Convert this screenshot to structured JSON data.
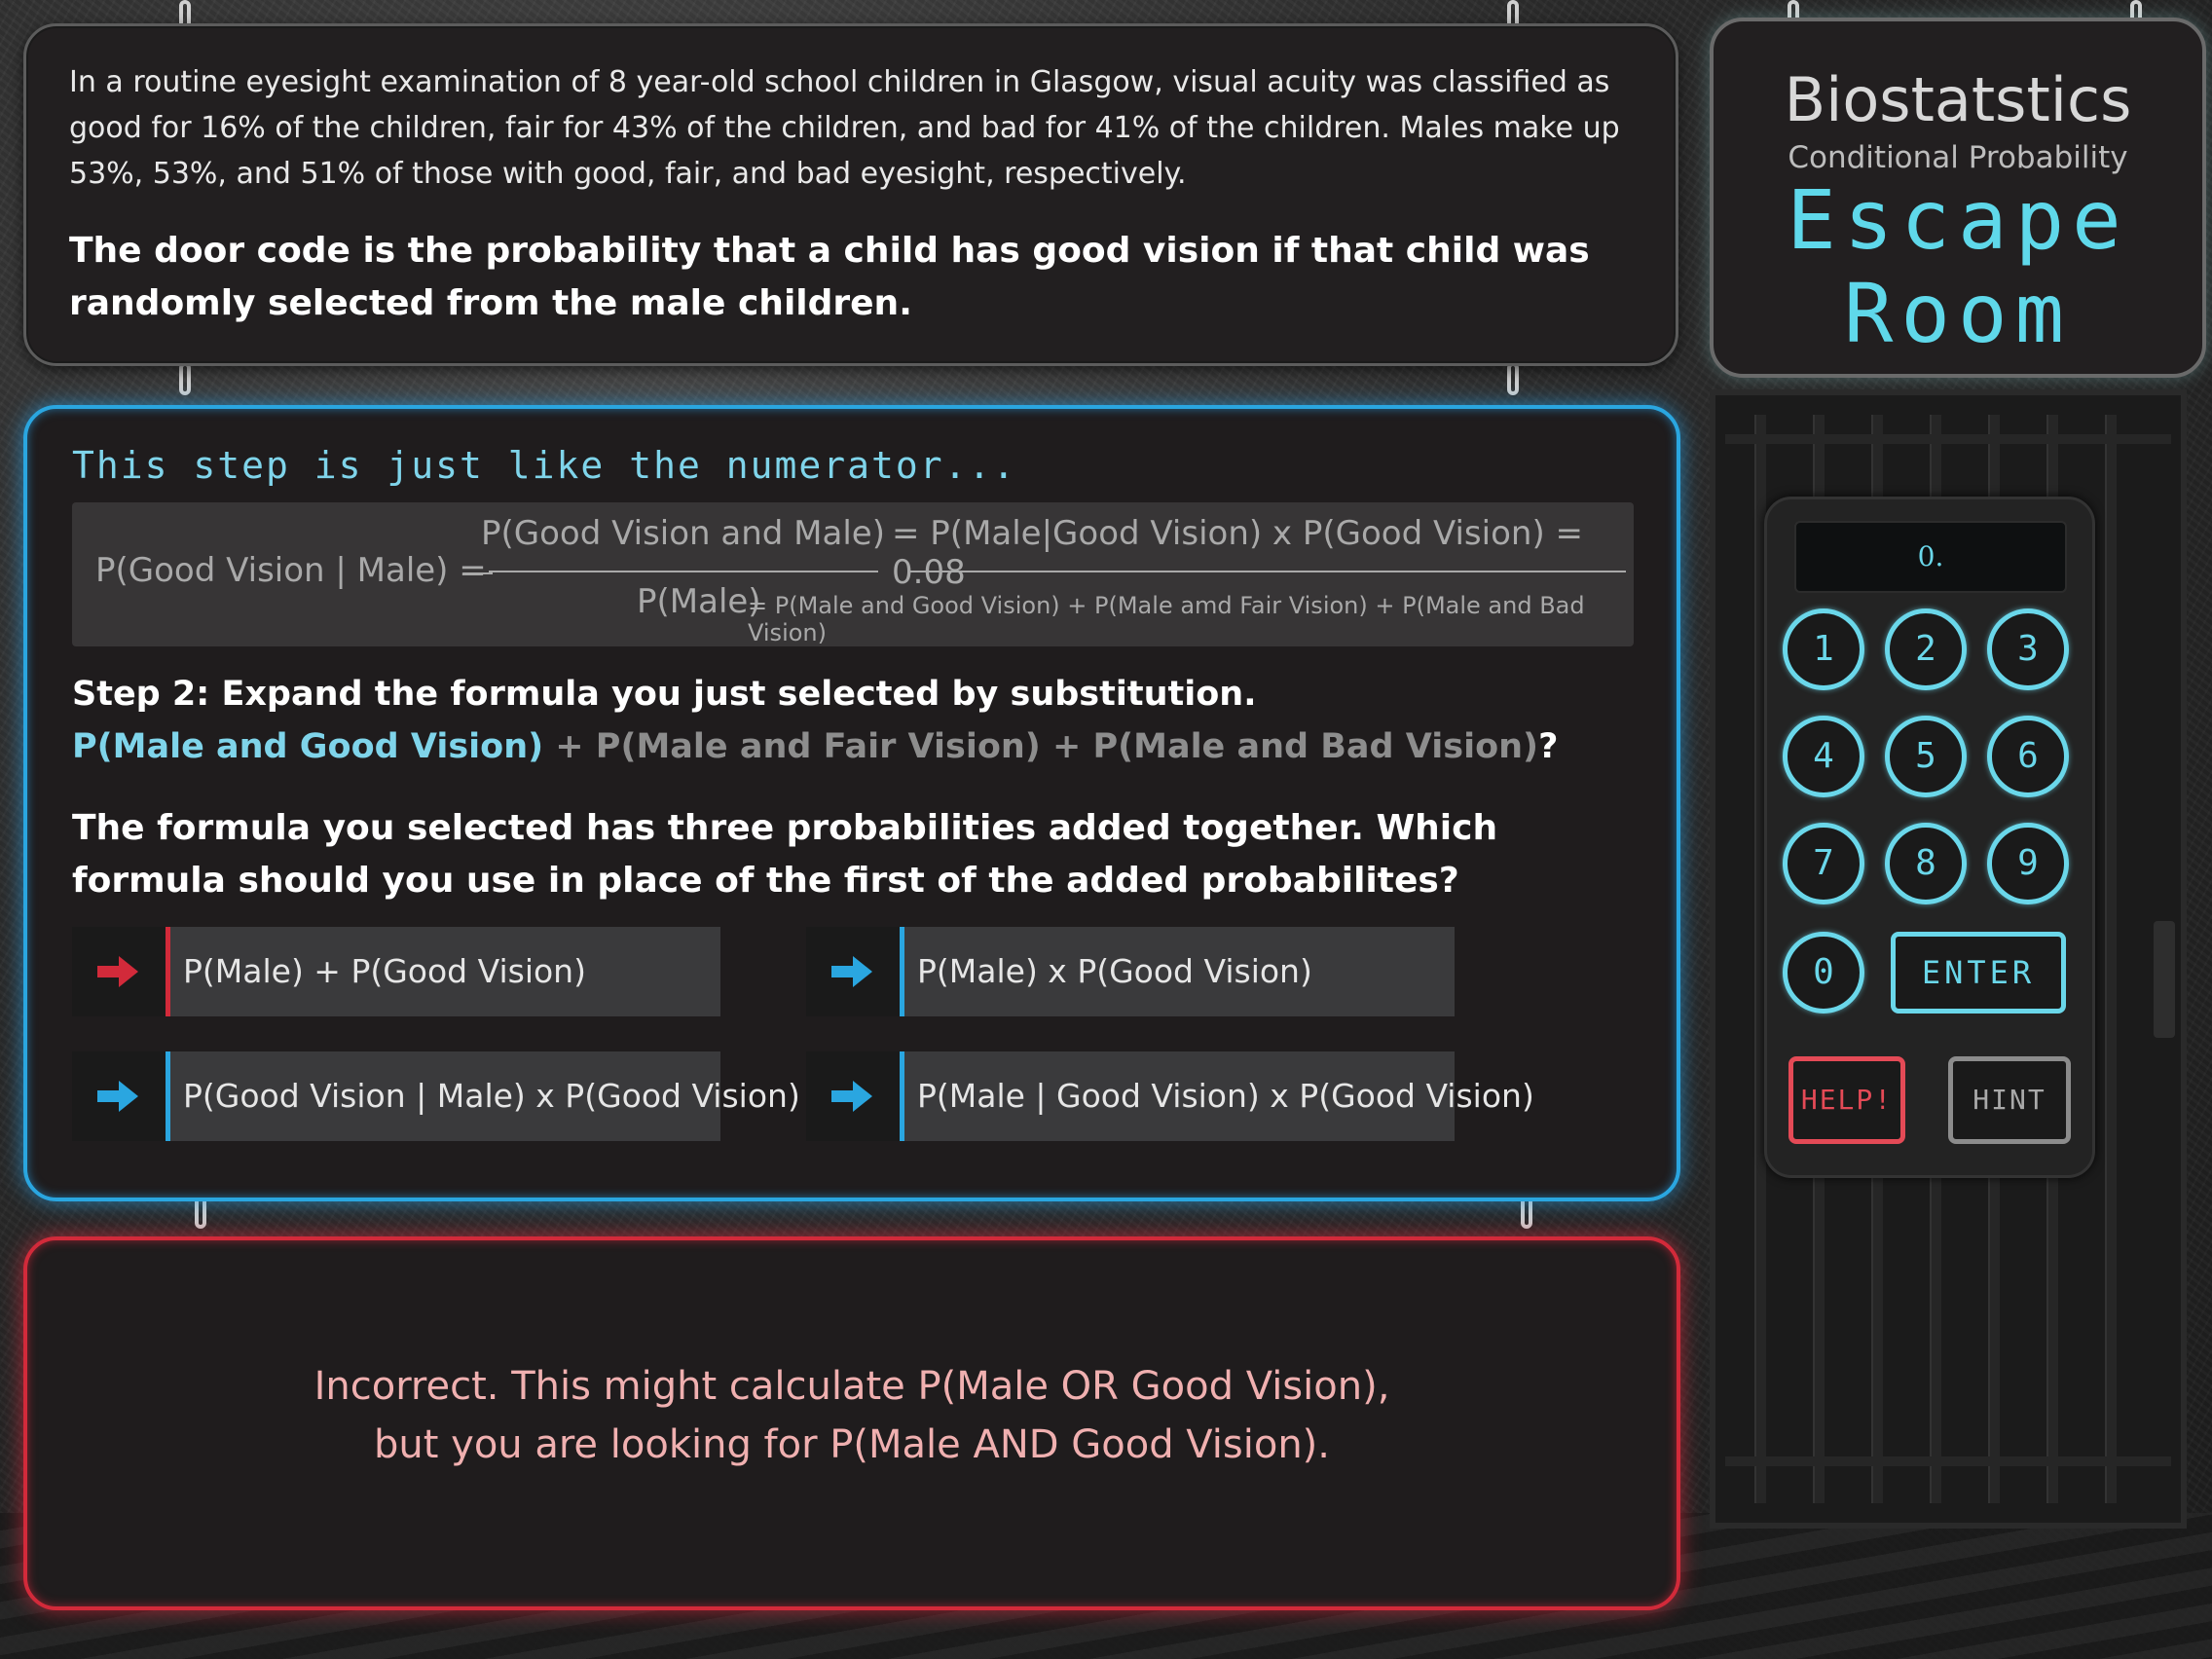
{
  "intro": "In a routine eyesight examination of 8 year-old school children in Glasgow, visual acuity was classified as good for 16% of the children, fair for 43% of the children, and bad for 41% of the children. Males make up 53%, 53%, and 51% of those with good, fair, and bad eyesight, respectively.",
  "question": "The door code is the probability that a child has good vision if that child was randomly selected from the male children.",
  "title": {
    "main": "Biostatstics",
    "sub": "Conditional Probability",
    "escape": "Escape",
    "room": "Room"
  },
  "step_header": "This step is just like the numerator...",
  "formula": {
    "lhs": "P(Good Vision | Male) =",
    "numerator": "P(Good Vision and Male)",
    "numerator_expand": "= P(Male|Good Vision) x P(Good Vision) = 0.08",
    "denominator": "P(Male)",
    "denominator_expand": "= P(Male and Good Vision) + P(Male amd Fair Vision) + P(Male and Bad Vision)"
  },
  "step2": {
    "title": "Step 2: Expand the formula you just selected by substitution.",
    "part_a": "P(Male and Good Vision)",
    "part_b": " + P(Male and Fair Vision) + P(Male and Bad Vision)",
    "part_c": "?"
  },
  "step3": "The formula you selected has three probabilities added together. Which formula should you use in place of the first of the added probabilites?",
  "options": [
    {
      "label": "P(Male) + P(Good Vision)",
      "state": "wrong"
    },
    {
      "label": "P(Male) x P(Good Vision)",
      "state": "normal"
    },
    {
      "label": "P(Good Vision | Male) x P(Good Vision)",
      "state": "normal"
    },
    {
      "label": "P(Male | Good Vision) x P(Good Vision)",
      "state": "normal"
    }
  ],
  "feedback": {
    "line1": "Incorrect. This might calculate P(Male OR Good Vision),",
    "line2": "but you are looking for P(Male AND Good Vision)."
  },
  "keypad": {
    "display": "0.",
    "keys": [
      "1",
      "2",
      "3",
      "4",
      "5",
      "6",
      "7",
      "8",
      "9",
      "0"
    ],
    "enter": "ENTER",
    "help": "HELP!",
    "hint": "HINT"
  },
  "colors": {
    "accent_blue": "#2aa6e0",
    "accent_red": "#d22a3a",
    "cyan": "#6ad7ea"
  }
}
